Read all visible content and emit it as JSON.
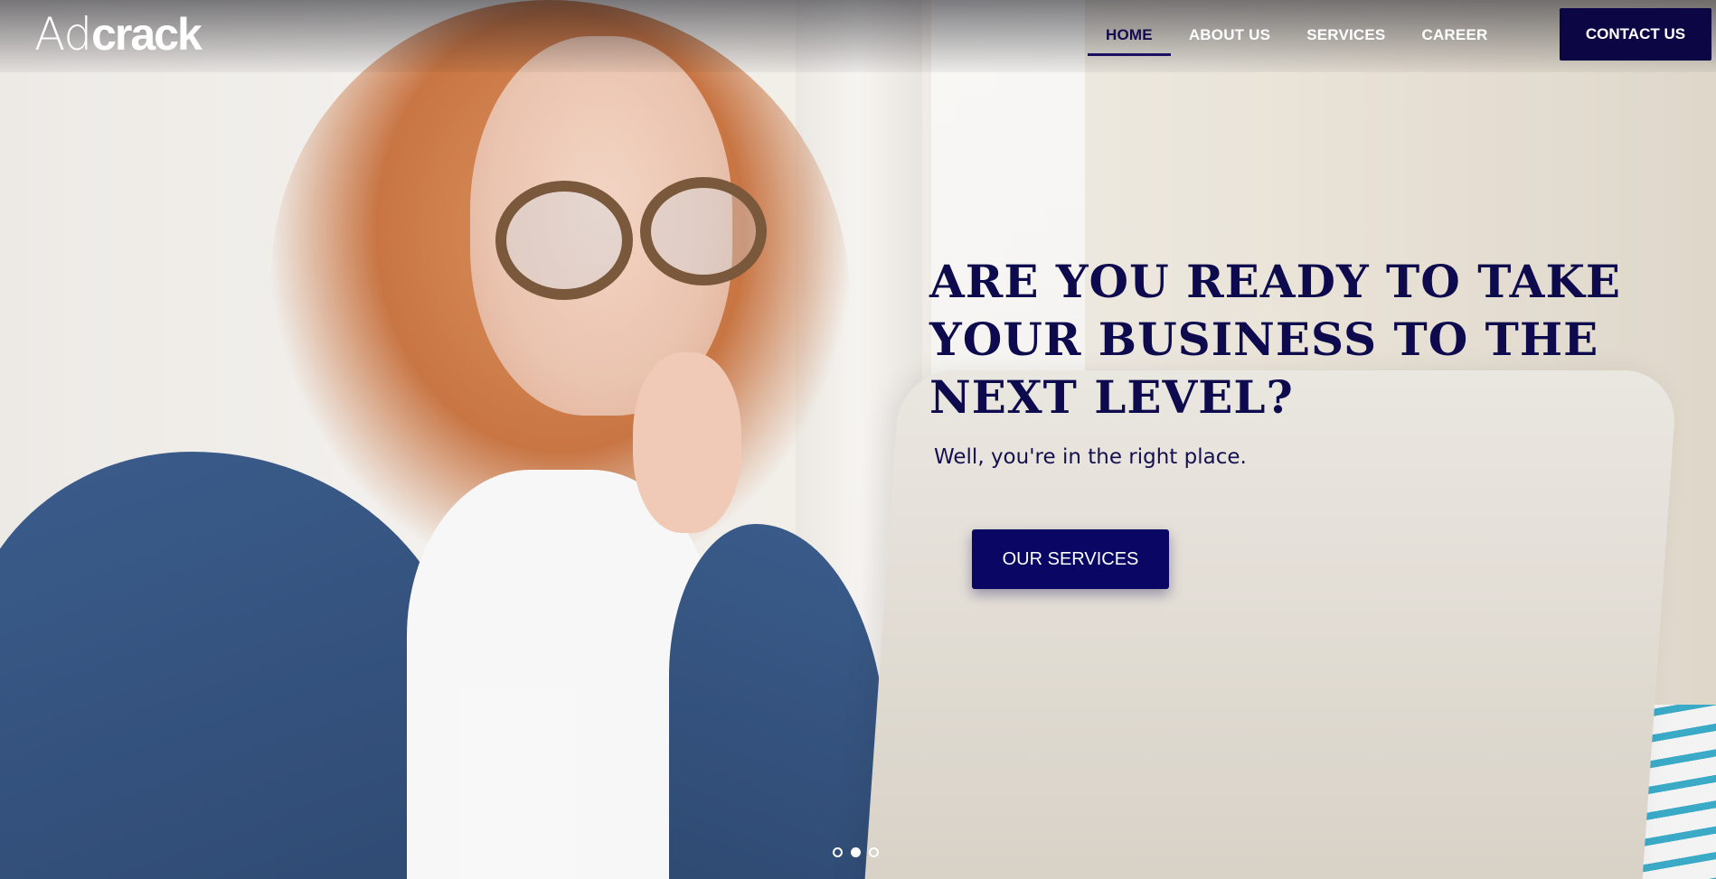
{
  "header": {
    "logo": {
      "thin": "Ad",
      "bold": "crack"
    },
    "nav": [
      {
        "label": "HOME",
        "active": true
      },
      {
        "label": "ABOUT US",
        "active": false
      },
      {
        "label": "SERVICES",
        "active": false
      },
      {
        "label": "CAREER",
        "active": false
      }
    ],
    "contact_label": "CONTACT US"
  },
  "hero": {
    "headline": "Are you ready to take your business to the next level?",
    "subline": "Well, you're in the right place.",
    "cta_label": "OUR SERVICES",
    "carousel": {
      "slides": 3,
      "active_index": 1
    }
  },
  "colors": {
    "brand_dark": "#0c0645",
    "headline": "#0d0a4d",
    "cta": "#0a0664"
  }
}
